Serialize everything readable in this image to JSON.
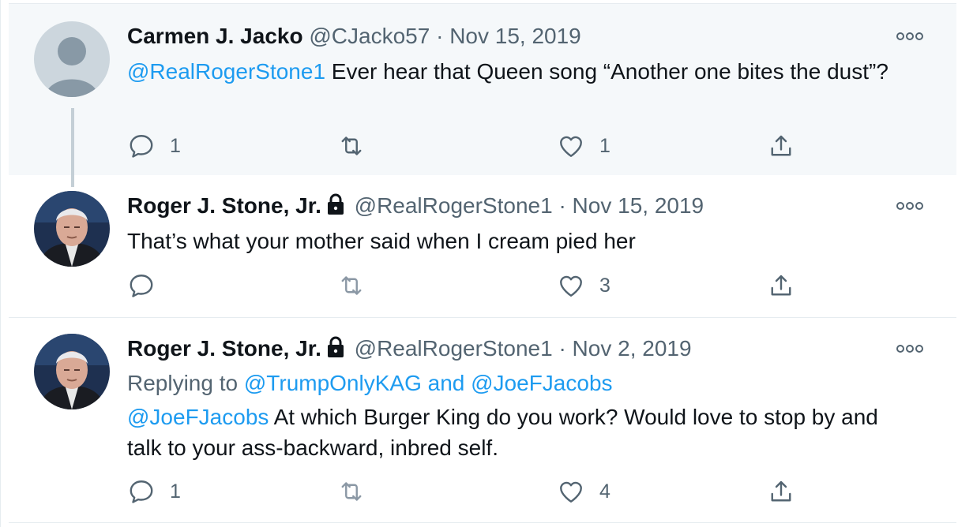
{
  "tweets": [
    {
      "name": "Carmen J. Jacko",
      "handle": "@CJacko57",
      "separator": "·",
      "date": "Nov 15, 2019",
      "locked": false,
      "mention": "@RealRogerStone1",
      "text": " Ever hear that Queen song “Another one bites the dust”?",
      "replies": "1",
      "retweets": "",
      "likes": "1"
    },
    {
      "name": "Roger J. Stone, Jr.",
      "handle": "@RealRogerStone1",
      "separator": "·",
      "date": "Nov 15, 2019",
      "locked": true,
      "text": "That’s what your mother said when I cream pied her",
      "replies": "",
      "retweets": "",
      "likes": "3"
    },
    {
      "name": "Roger J. Stone, Jr.",
      "handle": "@RealRogerStone1",
      "separator": "·",
      "date": "Nov 2, 2019",
      "locked": true,
      "replying_prefix": "Replying to ",
      "replying_to": "@TrumpOnlyKAG and @JoeFJacobs",
      "mention": "@JoeFJacobs",
      "text": " At which Burger King do you work? Would love to stop by and talk to your ass-backward, inbred self.",
      "replies": "1",
      "retweets": "",
      "likes": "4"
    }
  ],
  "icons": {
    "reply": "speech-bubble-icon",
    "retweet": "retweet-icon",
    "like": "heart-icon",
    "share": "share-icon",
    "more": "more-options-icon",
    "lock": "lock-icon"
  },
  "colors": {
    "link": "#1d9bf0",
    "muted": "#536471",
    "highlight_bg": "#f5f8fa"
  }
}
